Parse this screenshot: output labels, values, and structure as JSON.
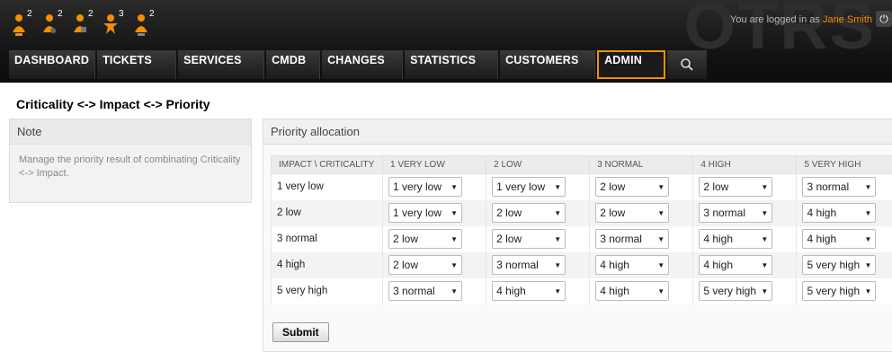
{
  "header": {
    "logo": "OTRS",
    "icons": [
      {
        "name": "locked-tickets-icon",
        "count": "2"
      },
      {
        "name": "watched-tickets-icon",
        "count": "2"
      },
      {
        "name": "responsible-tickets-icon",
        "count": "2"
      },
      {
        "name": "escalated-tickets-icon",
        "count": "3"
      },
      {
        "name": "new-tickets-icon",
        "count": "2"
      }
    ],
    "login_prefix": "You are logged in as",
    "user": "Jane Smith",
    "logout_icon": "power-icon"
  },
  "nav": {
    "items": [
      "DASHBOARD",
      "TICKETS",
      "SERVICES",
      "CMDB",
      "CHANGES",
      "STATISTICS",
      "CUSTOMERS",
      "ADMIN"
    ],
    "active": "ADMIN",
    "search_icon": "search-icon"
  },
  "page": {
    "title": "Criticality <-> Impact <-> Priority"
  },
  "sidebar": {
    "header": "Note",
    "text": "Manage the priority result of combinating Criticality <-> Impact."
  },
  "main": {
    "header": "Priority allocation",
    "columns": [
      "IMPACT \\ CRITICALITY",
      "1 VERY LOW",
      "2 LOW",
      "3 NORMAL",
      "4 HIGH",
      "5 VERY HIGH"
    ],
    "rows": [
      {
        "label": "1 very low",
        "values": [
          "1 very low",
          "1 very low",
          "2 low",
          "2 low",
          "3 normal"
        ]
      },
      {
        "label": "2 low",
        "values": [
          "1 very low",
          "2 low",
          "2 low",
          "3 normal",
          "4 high"
        ]
      },
      {
        "label": "3 normal",
        "values": [
          "2 low",
          "2 low",
          "3 normal",
          "4 high",
          "4 high"
        ]
      },
      {
        "label": "4 high",
        "values": [
          "2 low",
          "3 normal",
          "4 high",
          "4 high",
          "5 very high"
        ]
      },
      {
        "label": "5 very high",
        "values": [
          "3 normal",
          "4 high",
          "4 high",
          "5 very high",
          "5 very high"
        ]
      }
    ],
    "submit_label": "Submit"
  },
  "colors": {
    "accent": "#f39000",
    "header_bg": "#111111"
  }
}
